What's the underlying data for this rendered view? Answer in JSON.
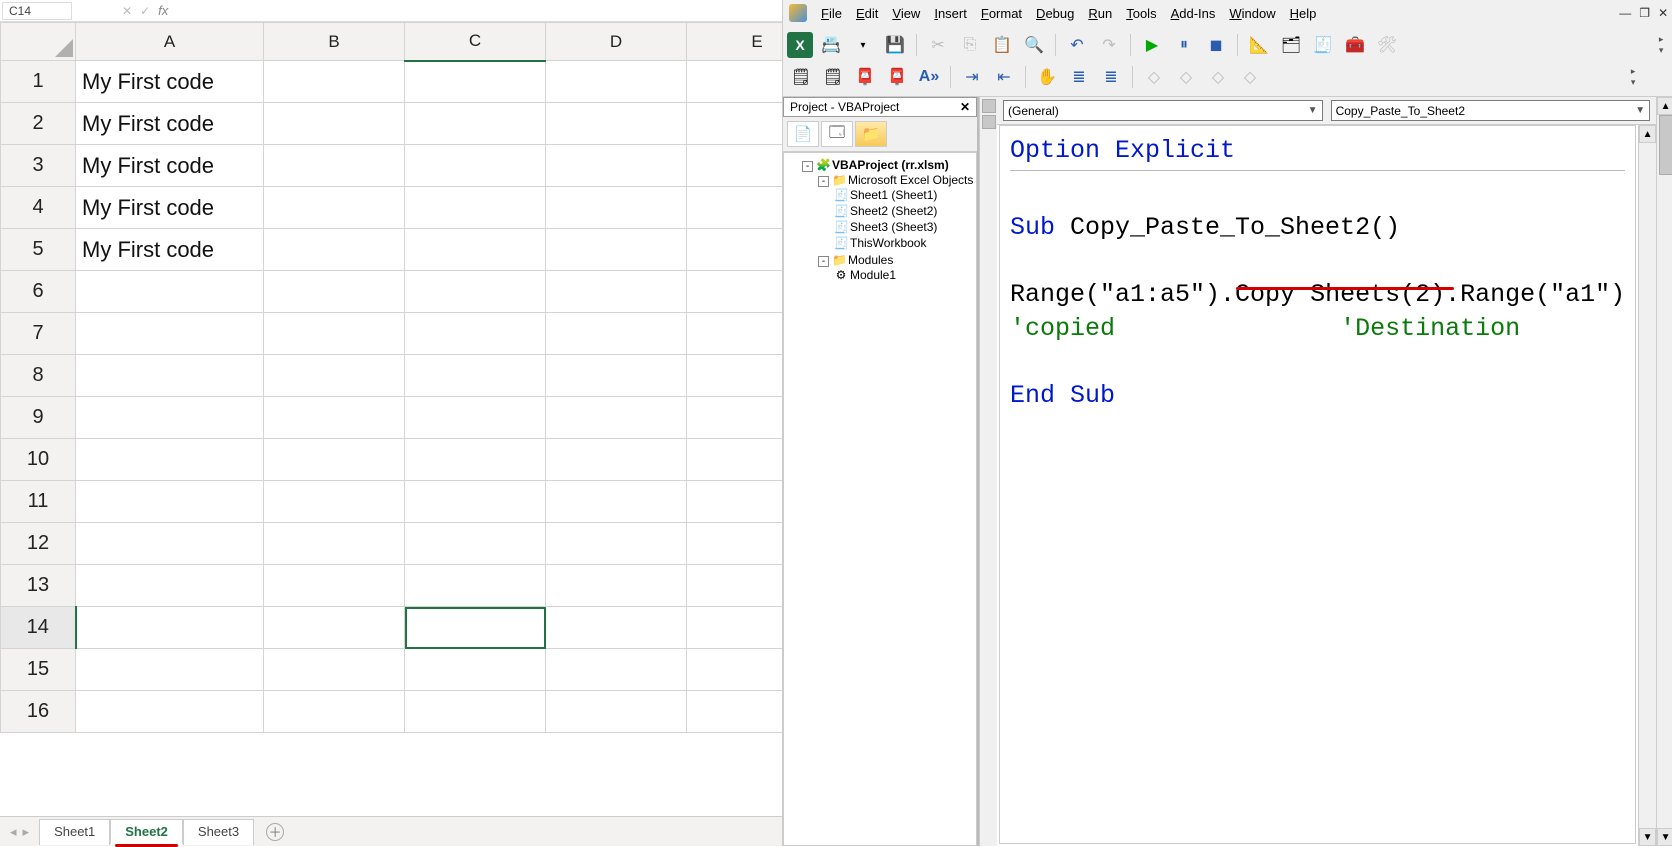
{
  "excel": {
    "namebox": "C14",
    "columns": [
      "A",
      "B",
      "C",
      "D",
      "E"
    ],
    "rowCount": 16,
    "activeRow": 14,
    "activeCol": "C",
    "cells": {
      "A1": "My First code",
      "A2": "My First code",
      "A3": "My First code",
      "A4": "My First code",
      "A5": "My First code"
    },
    "tabs": [
      "Sheet1",
      "Sheet2",
      "Sheet3"
    ],
    "activeTab": "Sheet2"
  },
  "vba": {
    "menu": [
      "File",
      "Edit",
      "View",
      "Insert",
      "Format",
      "Debug",
      "Run",
      "Tools",
      "Add-Ins",
      "Window",
      "Help"
    ],
    "projectTitle": "Project - VBAProject",
    "tree": {
      "project": "VBAProject (rr.xlsm)",
      "excelObjects": "Microsoft Excel Objects",
      "sheets": [
        "Sheet1 (Sheet1)",
        "Sheet2 (Sheet2)",
        "Sheet3 (Sheet3)"
      ],
      "workbook": "ThisWorkbook",
      "modulesLabel": "Modules",
      "modules": [
        "Module1"
      ]
    },
    "dropdownLeft": "(General)",
    "dropdownRight": "Copy_Paste_To_Sheet2",
    "code": {
      "l1": "Option Explicit",
      "l2": "Sub",
      "l2b": " Copy_Paste_To_Sheet2()",
      "l3a": "Range(\"a1:a5\").Copy ",
      "l3b": "Sheets(2).Range(\"a1\")",
      "l4a": "'copied",
      "l4b": "'Destination",
      "l5": "End Sub"
    }
  }
}
